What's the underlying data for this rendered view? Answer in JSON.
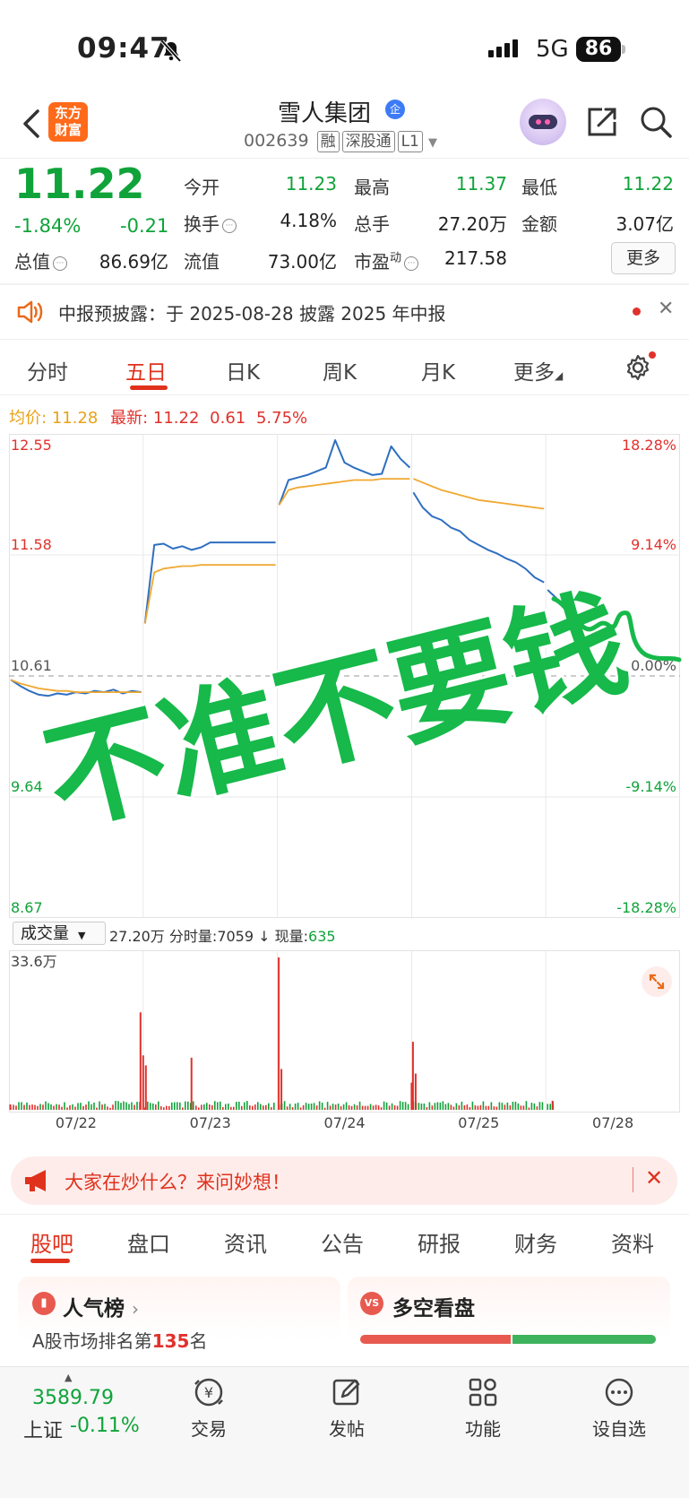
{
  "status_bar": {
    "time": "09:47",
    "network": "5G",
    "battery": "86"
  },
  "header": {
    "logo_line1": "东方",
    "logo_line2": "财富",
    "stock_name": "雪人集团",
    "badge": "企",
    "code": "002639",
    "tags": [
      "融",
      "深股通",
      "L1"
    ]
  },
  "quote": {
    "price": "11.22",
    "change_pct": "-1.84%",
    "change_val": "-0.21",
    "fields": [
      {
        "label": "今开",
        "value": "11.23",
        "color": "#10a33a"
      },
      {
        "label": "最高",
        "value": "11.37",
        "color": "#10a33a"
      },
      {
        "label": "最低",
        "value": "11.22",
        "color": "#10a33a"
      },
      {
        "label": "换手",
        "value": "4.18%",
        "color": "#222222"
      },
      {
        "label": "总手",
        "value": "27.20万",
        "color": "#222222"
      },
      {
        "label": "金额",
        "value": "3.07亿",
        "color": "#222222"
      },
      {
        "label": "总值",
        "value": "86.69亿",
        "color": "#222222"
      },
      {
        "label": "流值",
        "value": "73.00亿",
        "color": "#222222"
      },
      {
        "label": "市盈",
        "sup": "动",
        "value": "217.58",
        "color": "#222222"
      }
    ],
    "more": "更多"
  },
  "announcement": {
    "text": "中报预披露：于 2025-08-28 披露 2025 年中报"
  },
  "period_tabs": [
    "分时",
    "五日",
    "日K",
    "周K",
    "月K",
    "更多"
  ],
  "avg_line": {
    "avg_label": "均价:",
    "avg_value": "11.28",
    "latest_label": "最新:",
    "latest_value": "11.22",
    "change": "0.61",
    "pct": "5.75%"
  },
  "chart_data": {
    "type": "line",
    "title": "",
    "price_axis_left": [
      "12.55",
      "11.58",
      "10.61",
      "9.64",
      "8.67"
    ],
    "price_axis_right": [
      "18.28%",
      "9.14%",
      "0.00%",
      "-9.14%",
      "-18.28%"
    ],
    "ylim": [
      8.67,
      12.55
    ],
    "reference_price": 10.61,
    "dates": [
      "07/22",
      "07/23",
      "07/24",
      "07/25",
      "07/28"
    ],
    "series": [
      {
        "values": [
          [
            10.58,
            10.53,
            10.49,
            10.46,
            10.45,
            10.47,
            10.46,
            10.48,
            10.47,
            10.49,
            10.48,
            10.5,
            10.47,
            10.49,
            10.48
          ],
          [
            11.03,
            11.66,
            11.67,
            11.63,
            11.65,
            11.62,
            11.64,
            11.68,
            11.68,
            11.68,
            11.68,
            11.68,
            11.68,
            11.68,
            11.68
          ],
          [
            11.98,
            12.18,
            12.2,
            12.22,
            12.25,
            12.28,
            12.5,
            12.32,
            12.28,
            12.25,
            12.22,
            12.23,
            12.45,
            12.35,
            12.28
          ],
          [
            12.08,
            11.96,
            11.89,
            11.86,
            11.8,
            11.77,
            11.7,
            11.66,
            11.62,
            11.59,
            11.55,
            11.52,
            11.47,
            11.4,
            11.36
          ],
          [
            11.3,
            11.22
          ]
        ]
      },
      {
        "values": [
          [
            10.58,
            10.55,
            10.53,
            10.51,
            10.5,
            10.49,
            10.49,
            10.48,
            10.48,
            10.48,
            10.48,
            10.48,
            10.48,
            10.48,
            10.48
          ],
          [
            11.03,
            11.44,
            11.47,
            11.48,
            11.49,
            11.49,
            11.5,
            11.5,
            11.5,
            11.5,
            11.5,
            11.5,
            11.5,
            11.5,
            11.5
          ],
          [
            11.98,
            12.1,
            12.12,
            12.13,
            12.14,
            12.15,
            12.16,
            12.17,
            12.18,
            12.18,
            12.18,
            12.19,
            12.19,
            12.19,
            12.19
          ],
          [
            12.19,
            12.16,
            12.13,
            12.1,
            12.08,
            12.06,
            12.04,
            12.02,
            12.01,
            12.0,
            11.99,
            11.98,
            11.97,
            11.96,
            11.95
          ],
          []
        ]
      }
    ],
    "volume": {
      "max_label": "33.6万",
      "ymax": 33.6,
      "spikes": [
        {
          "day": 0,
          "pos": 0.01,
          "value": 1.2
        },
        {
          "day": 0,
          "pos": 0.98,
          "value": 21.5
        },
        {
          "day": 0,
          "pos": 1.0,
          "value": 12.0
        },
        {
          "day": 1,
          "pos": 0.02,
          "value": 9.8
        },
        {
          "day": 1,
          "pos": 0.36,
          "value": 11.5
        },
        {
          "day": 2,
          "pos": 0.01,
          "value": 33.6
        },
        {
          "day": 2,
          "pos": 0.03,
          "value": 9.0
        },
        {
          "day": 3,
          "pos": 0.0,
          "value": 6.0
        },
        {
          "day": 3,
          "pos": 0.01,
          "value": 15.0
        },
        {
          "day": 3,
          "pos": 0.03,
          "value": 8.0
        },
        {
          "day": 4,
          "pos": 0.05,
          "value": 2.0
        }
      ]
    }
  },
  "volume_bar": {
    "select": "成交量",
    "total": "27.20万",
    "time_vol_label": "分时量:",
    "time_vol": "7059",
    "cur_label": "现量:",
    "cur": "635"
  },
  "overlay_text": "不准不要钱",
  "banner": {
    "text": "大家在炒什么？来问妙想！"
  },
  "bottom_tabs": [
    "股吧",
    "盘口",
    "资讯",
    "公告",
    "研报",
    "财务",
    "资料"
  ],
  "cards": {
    "popularity_title": "人气榜",
    "rank_prefix": "A股市场排名第",
    "rank_num": "135",
    "rank_suffix": "名",
    "bullbear_title": "多空看盘"
  },
  "bottom_nav": {
    "index_value": "3589.79",
    "index_name": "上证",
    "index_change": "-0.11%",
    "items": [
      "交易",
      "发帖",
      "功能",
      "设自选"
    ]
  }
}
